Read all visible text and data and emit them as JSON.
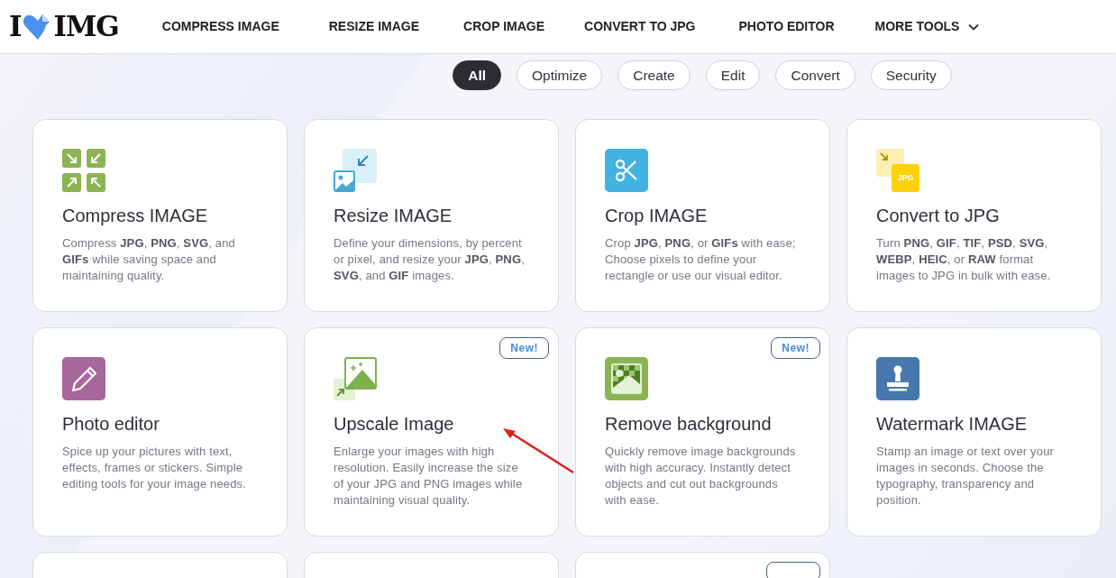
{
  "logo": {
    "left": "I",
    "right": "IMG"
  },
  "nav": [
    {
      "label": "COMPRESS IMAGE",
      "dropdown": false
    },
    {
      "label": "RESIZE IMAGE",
      "dropdown": false
    },
    {
      "label": "CROP IMAGE",
      "dropdown": false
    },
    {
      "label": "CONVERT TO JPG",
      "dropdown": false
    },
    {
      "label": "PHOTO EDITOR",
      "dropdown": false
    },
    {
      "label": "MORE TOOLS",
      "dropdown": true
    }
  ],
  "filters": [
    {
      "label": "All",
      "selected": true
    },
    {
      "label": "Optimize",
      "selected": false
    },
    {
      "label": "Create",
      "selected": false
    },
    {
      "label": "Edit",
      "selected": false
    },
    {
      "label": "Convert",
      "selected": false
    },
    {
      "label": "Security",
      "selected": false
    }
  ],
  "tools": [
    {
      "kind": "compress",
      "title": "Compress IMAGE",
      "description": "Compress **JPG**, **PNG**, **SVG**, and **GIFs** while saving space and maintaining quality."
    },
    {
      "kind": "resize",
      "title": "Resize IMAGE",
      "description": "Define your dimensions, by percent or pixel, and resize your **JPG**, **PNG**, **SVG**, and **GIF** images."
    },
    {
      "kind": "crop",
      "title": "Crop IMAGE",
      "description": "Crop **JPG**, **PNG**, or **GIFs** with ease; Choose pixels to define your rectangle or use our visual editor."
    },
    {
      "kind": "convert",
      "icon_label": "JPG",
      "title": "Convert to JPG",
      "description": "Turn **PNG**, **GIF**, **TIF**, **PSD**, **SVG**, **WEBP**, **HEIC**, or **RAW** format images to JPG in bulk with ease."
    },
    {
      "kind": "editor",
      "title": "Photo editor",
      "description": "Spice up your pictures with text, effects, frames or stickers. Simple editing tools for your image needs."
    },
    {
      "kind": "upscale",
      "badge": "New!",
      "title": "Upscale Image",
      "description": "Enlarge your images with high resolution. Easily increase the size of your JPG and PNG images while maintaining visual quality."
    },
    {
      "kind": "removebg",
      "badge": "New!",
      "title": "Remove background",
      "description": "Quickly remove image backgrounds with high accuracy. Instantly detect objects and cut out backgrounds with ease."
    },
    {
      "kind": "watermark",
      "title": "Watermark IMAGE",
      "description": "Stamp an image or text over your images in seconds. Choose the typography, transparency and position."
    }
  ],
  "more_cards": [
    {
      "badge_shown": false
    },
    {
      "badge_shown": false
    },
    {
      "badge_shown": true
    }
  ]
}
